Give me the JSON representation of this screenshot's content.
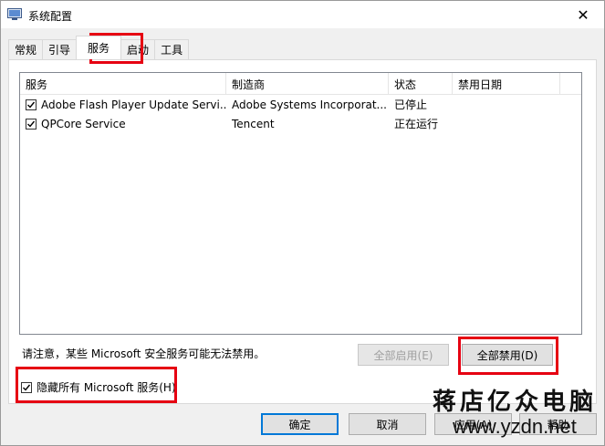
{
  "window": {
    "title": "系统配置",
    "close_glyph": "✕"
  },
  "tabs": [
    {
      "label": "常规"
    },
    {
      "label": "引导"
    },
    {
      "label": "服务",
      "active": true
    },
    {
      "label": "启动"
    },
    {
      "label": "工具"
    }
  ],
  "services": {
    "columns": [
      "服务",
      "制造商",
      "状态",
      "禁用日期"
    ],
    "rows": [
      {
        "checked": true,
        "name": "Adobe Flash Player Update Servi...",
        "vendor": "Adobe Systems Incorporat...",
        "status": "已停止",
        "disabled_date": ""
      },
      {
        "checked": true,
        "name": "QPCore Service",
        "vendor": "Tencent",
        "status": "正在运行",
        "disabled_date": ""
      }
    ]
  },
  "note": "请注意，某些 Microsoft 安全服务可能无法禁用。",
  "buttons": {
    "enable_all": "全部启用(E)",
    "disable_all": "全部禁用(D)",
    "ok": "确定",
    "cancel": "取消",
    "apply": "应用(A)",
    "help": "帮助"
  },
  "hide_ms": {
    "checked": true,
    "label": "隐藏所有 Microsoft 服务(H)"
  },
  "watermark": {
    "brand": "蒋店亿众电脑",
    "url": "www.yzdn.net"
  },
  "colors": {
    "highlight": "#e60012",
    "focus": "#0078d7"
  }
}
